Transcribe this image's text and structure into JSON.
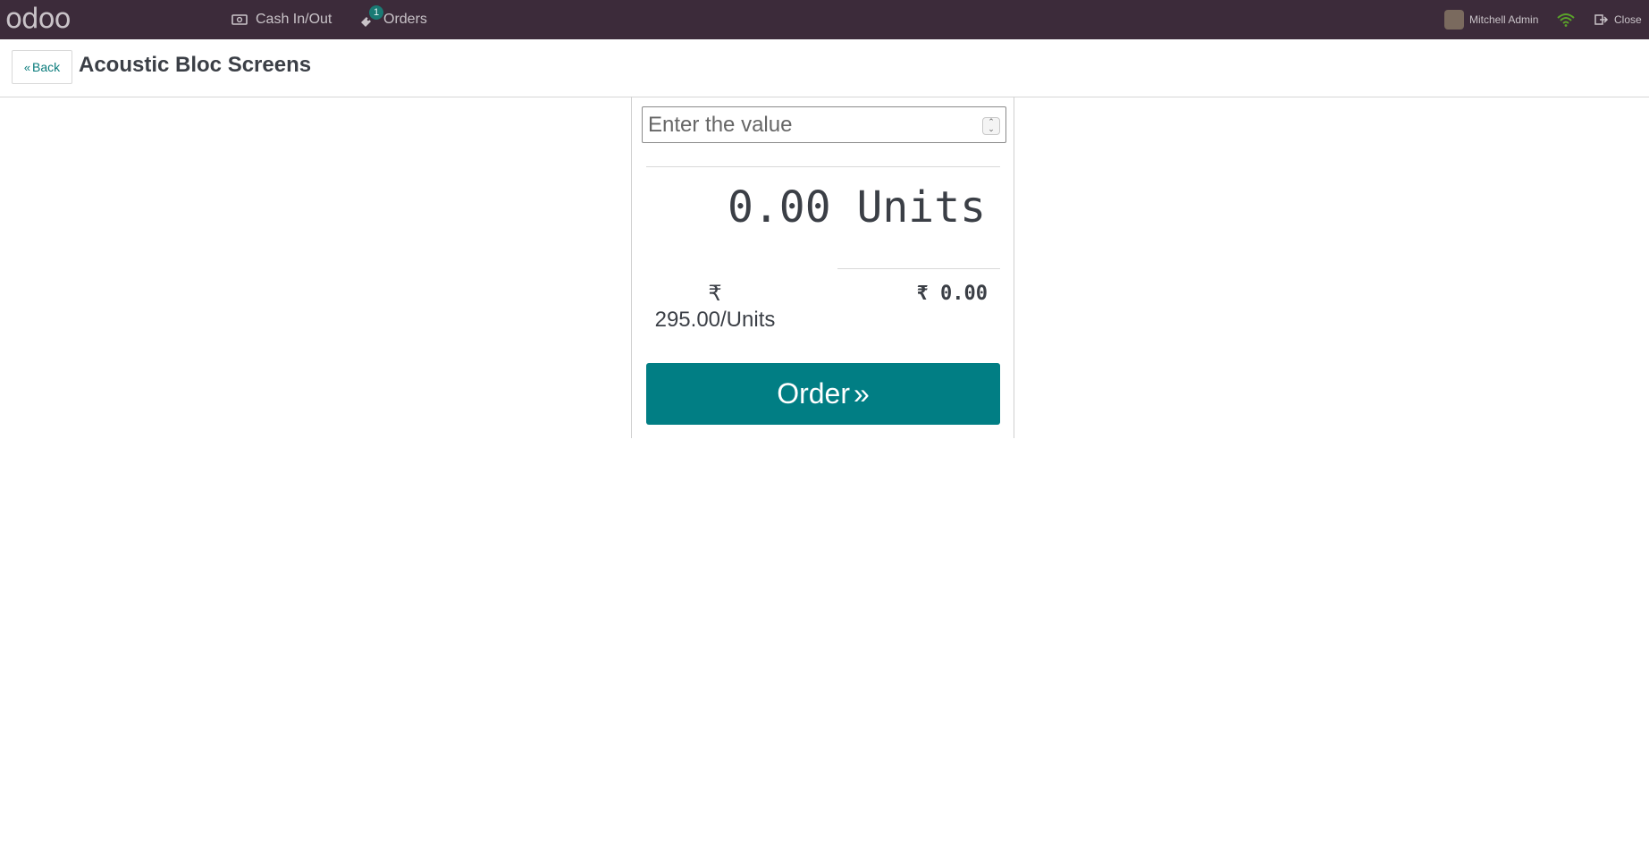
{
  "topbar": {
    "logo_text": "odoo",
    "nav": [
      {
        "label": "Cash In/Out",
        "icon": "money-icon"
      },
      {
        "label": "Orders",
        "icon": "orders-icon",
        "badge": "1"
      }
    ],
    "user_name": "Mitchell Admin",
    "close_label": "Close"
  },
  "header": {
    "back_label": "Back",
    "title": "Acoustic Bloc Screens"
  },
  "panel": {
    "input_placeholder": "Enter the value",
    "quantity": "0.00",
    "quantity_unit": "Units",
    "unit_price_symbol": "₹",
    "unit_price": "295.00/Units",
    "total": "₹ 0.00",
    "order_label": "Order"
  },
  "colors": {
    "topbar": "#3c2b3a",
    "accent": "#017e84"
  }
}
